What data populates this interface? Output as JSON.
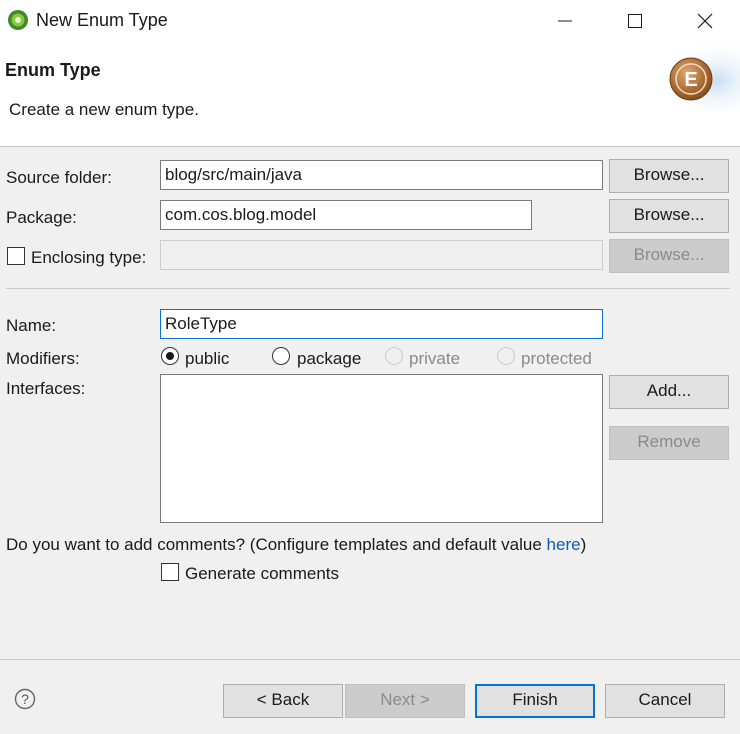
{
  "window": {
    "title": "New Enum Type"
  },
  "banner": {
    "title": "Enum Type",
    "description": "Create a new enum type.",
    "logo_letter": "E"
  },
  "form": {
    "source_folder_label": "Source folder:",
    "source_folder_value": "blog/src/main/java",
    "package_label": "Package:",
    "package_value": "com.cos.blog.model",
    "enclosing_type_label": "Enclosing type:",
    "enclosing_type_value": "",
    "browse_label": "Browse...",
    "name_label": "Name:",
    "name_value": "RoleType",
    "modifiers_label": "Modifiers:",
    "modifiers": [
      {
        "label": "public",
        "selected": true,
        "enabled": true
      },
      {
        "label": "package",
        "selected": false,
        "enabled": true
      },
      {
        "label": "private",
        "selected": false,
        "enabled": false
      },
      {
        "label": "protected",
        "selected": false,
        "enabled": false
      }
    ],
    "interfaces_label": "Interfaces:",
    "add_label": "Add...",
    "remove_label": "Remove",
    "comments_prompt": "Do you want to add comments? (Configure templates and default value ",
    "comments_link": "here",
    "comments_close": ")",
    "generate_comments_label": "Generate comments",
    "generate_comments_checked": false
  },
  "footer": {
    "help_icon": "question-circle-icon",
    "back_label": "< Back",
    "next_label": "Next >",
    "finish_label": "Finish",
    "cancel_label": "Cancel"
  },
  "colors": {
    "background": "#f0f0f0",
    "focus_border": "#0a70d4",
    "link": "#0a5fb4",
    "logo": "#b5733a"
  }
}
